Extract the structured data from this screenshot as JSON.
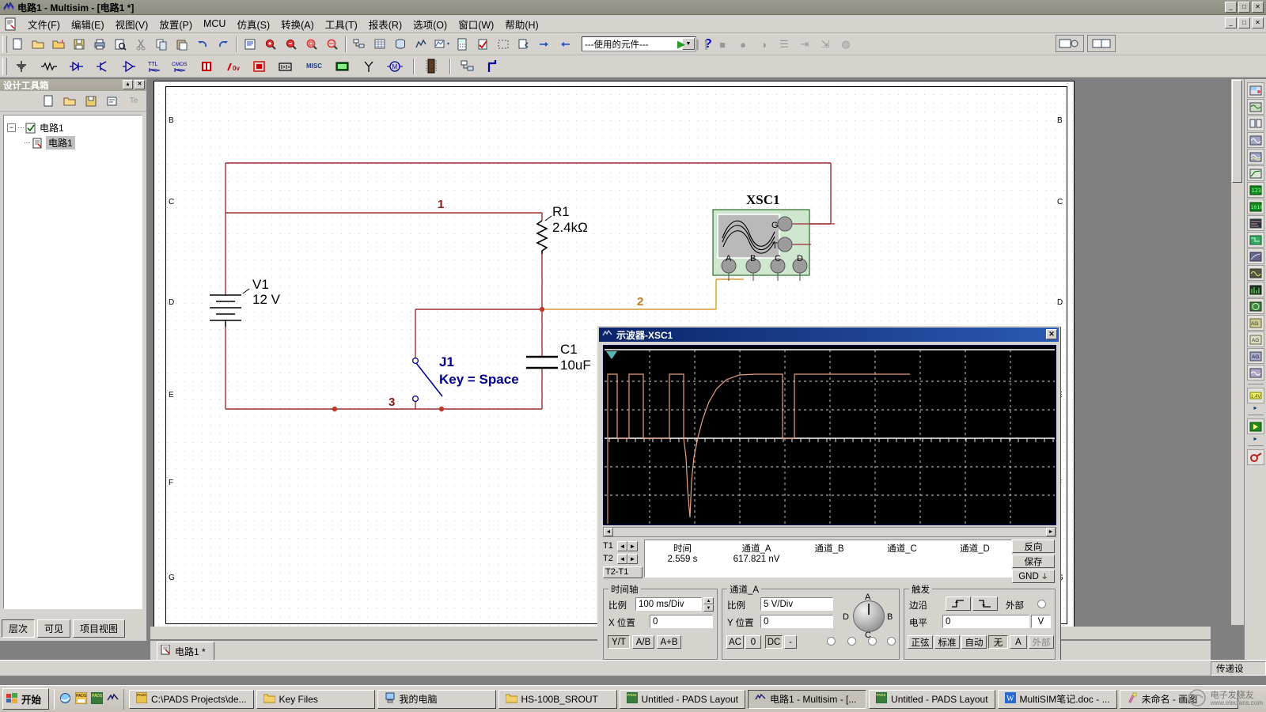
{
  "window": {
    "title": "电路1 - Multisim - [电路1 *]",
    "icon": "multisim-icon",
    "buttons": [
      "_",
      "□",
      "✕"
    ],
    "mdi_buttons": [
      "_",
      "□",
      "✕"
    ]
  },
  "menu": {
    "items": [
      {
        "label": "文件(F)",
        "name": "menu-file"
      },
      {
        "label": "编辑(E)",
        "name": "menu-edit"
      },
      {
        "label": "视图(V)",
        "name": "menu-view"
      },
      {
        "label": "放置(P)",
        "name": "menu-place"
      },
      {
        "label": "MCU",
        "name": "menu-mcu"
      },
      {
        "label": "仿真(S)",
        "name": "menu-simulate"
      },
      {
        "label": "转换(A)",
        "name": "menu-transfer"
      },
      {
        "label": "工具(T)",
        "name": "menu-tools"
      },
      {
        "label": "报表(R)",
        "name": "menu-reports"
      },
      {
        "label": "选项(O)",
        "name": "menu-options"
      },
      {
        "label": "窗口(W)",
        "name": "menu-window"
      },
      {
        "label": "帮助(H)",
        "name": "menu-help"
      }
    ]
  },
  "toolbar_main": {
    "groups": [
      [
        "new-file-icon",
        "open-file-icon",
        "open-sample-icon",
        "save-icon",
        "print-icon",
        "print-preview-icon",
        "cut-icon",
        "copy-icon",
        "paste-icon",
        "undo-icon",
        "redo-icon"
      ],
      [
        "full-screen-icon",
        "zoom-in-icon",
        "zoom-out-icon",
        "zoom-area-icon",
        "zoom-fit-icon"
      ],
      [
        "hierarchy-icon",
        "grid-icon",
        "database-icon",
        "analysis-icon",
        "postprocessor-icon",
        "calculator-icon",
        "check-icon",
        "select-area-icon",
        "back-annotate-icon",
        "forward-annotate-icon",
        "in-use-list-icon"
      ]
    ],
    "in_use_combo": "---使用的元件---",
    "help_icon": "help-question-icon"
  },
  "toolbar_components": {
    "items": [
      "source-icon",
      "basic-icon",
      "diode-icon",
      "transistor-icon",
      "analog-icon",
      "ttl-icon",
      "cmos-icon",
      "misc-digital-icon",
      "mixed-icon",
      "indicator-icon",
      "power-icon",
      "misc-icon",
      "advanced-peripheral-icon",
      "rf-icon",
      "electromech-icon",
      "mcu-icon",
      "hierarchical-block-icon",
      "bus-icon"
    ]
  },
  "simulation_controls": {
    "items": [
      "run-icon",
      "pause-icon",
      "stop-icon",
      "record-icon",
      "step-icon",
      "list-icon",
      "measure-icon",
      "grapher-icon",
      "instrument-icon"
    ],
    "run_color": "#2a9c2a",
    "right_boxes": [
      "view-mode-icon",
      "layout-mode-icon"
    ]
  },
  "design_toolbox": {
    "title": "设计工具箱",
    "header_buttons": [
      "▴",
      "✕"
    ],
    "toolbar_icons": [
      "new-sheet-icon",
      "open-sheet-icon",
      "save-sheet-icon",
      "rename-sheet-icon",
      "text-icon"
    ],
    "tree": {
      "root": {
        "label": "电路1",
        "icon": "checked-sheet-icon",
        "expander": "−"
      },
      "child": {
        "label": "电路1",
        "icon": "schematic-icon",
        "selected": true
      }
    },
    "tabs": [
      {
        "label": "层次",
        "active": true
      },
      {
        "label": "可见",
        "active": false
      },
      {
        "label": "项目视图",
        "active": false
      }
    ]
  },
  "schematic": {
    "sheet_tab": {
      "label": "电路1 *",
      "icon": "schematic-tab-icon"
    },
    "row_labels": [
      "B",
      "C",
      "D",
      "E",
      "F",
      "G"
    ],
    "components": [
      {
        "ref": "V1",
        "value": "12 V",
        "type": "dc-voltage-source"
      },
      {
        "ref": "R1",
        "value": "2.4kΩ",
        "type": "resistor"
      },
      {
        "ref": "C1",
        "value": "10uF",
        "type": "capacitor"
      },
      {
        "ref": "J1",
        "value": "Key = Space",
        "type": "spdt-switch"
      },
      {
        "ref": "XSC1",
        "value": "",
        "type": "oscilloscope"
      }
    ],
    "net_labels": [
      "1",
      "2",
      "3"
    ],
    "scope_terminals": [
      "A",
      "B",
      "C",
      "D",
      "G",
      "T"
    ]
  },
  "scope": {
    "title": "示波器-XSC1",
    "close_label": "✕",
    "readout": {
      "cursors": [
        "T1",
        "T2"
      ],
      "delta_label": "T2-T1",
      "columns": [
        "时间",
        "通道_A",
        "通道_B",
        "通道_C",
        "通道_D"
      ],
      "t1_values": [
        "2.559 s",
        "617.821 nV",
        "",
        "",
        ""
      ],
      "buttons": [
        {
          "label": "反向",
          "name": "reverse-button"
        },
        {
          "label": "保存",
          "name": "save-button"
        },
        {
          "label": "GND",
          "name": "gnd-button"
        }
      ]
    },
    "timebase": {
      "caption": "时间轴",
      "scale_label": "比例",
      "scale_value": "100 ms/Div",
      "xpos_label": "X 位置",
      "xpos_value": "0",
      "modes": [
        {
          "label": "Y/T",
          "active": true
        },
        {
          "label": "A/B",
          "active": false
        },
        {
          "label": "A+B",
          "active": false
        }
      ]
    },
    "channel_a": {
      "caption": "通道_A",
      "scale_label": "比例",
      "scale_value": "5  V/Div",
      "ypos_label": "Y 位置",
      "ypos_value": "0",
      "coupling": [
        {
          "label": "AC",
          "active": false
        },
        {
          "label": "0",
          "active": false
        },
        {
          "label": "DC",
          "active": true
        },
        {
          "label": "-",
          "active": false
        }
      ]
    },
    "channel_knob": {
      "top": "A",
      "right": "B",
      "bottom": "C",
      "left": "D"
    },
    "trigger": {
      "caption": "触发",
      "edge_label": "边沿",
      "edge_buttons": [
        "rising-edge-icon",
        "falling-edge-icon"
      ],
      "external_label": "外部",
      "level_label": "电平",
      "level_value": "0",
      "level_unit": "V",
      "sources": [
        {
          "label": "正弦",
          "active": false
        },
        {
          "label": "标准",
          "active": false
        },
        {
          "label": "自动",
          "active": false
        },
        {
          "label": "无",
          "active": true
        },
        {
          "label": "A",
          "active": false
        },
        {
          "label": "外部",
          "active": false
        }
      ]
    }
  },
  "chart_data": {
    "type": "line",
    "title": "示波器-XSC1",
    "xlabel": "时间",
    "ylabel": "通道_A",
    "x_scale": "100 ms/Div",
    "y_scale": "5 V/Div",
    "x_position": 0,
    "y_position": 0,
    "grid": true,
    "divisions": {
      "x": 10,
      "y": 8
    },
    "trace_color": "#e8a482",
    "series": [
      {
        "name": "通道_A",
        "points": [
          [
            0.0,
            0.0
          ],
          [
            0.0,
            12.0
          ],
          [
            0.02,
            12.0
          ],
          [
            0.02,
            0.0
          ],
          [
            0.05,
            0.0
          ],
          [
            0.05,
            12.0
          ],
          [
            0.08,
            12.0
          ],
          [
            0.08,
            0.0
          ],
          [
            0.13,
            0.0
          ],
          [
            0.13,
            12.0
          ],
          [
            0.18,
            12.0
          ],
          [
            0.18,
            0.0
          ],
          [
            0.19,
            -6.0
          ],
          [
            0.2,
            -12.0
          ],
          [
            0.21,
            -3.0
          ],
          [
            0.23,
            3.0
          ],
          [
            0.26,
            8.0
          ],
          [
            0.3,
            11.0
          ],
          [
            0.34,
            12.0
          ],
          [
            0.42,
            12.0
          ],
          [
            0.42,
            0.0
          ],
          [
            0.45,
            0.0
          ],
          [
            0.45,
            12.0
          ],
          [
            0.67,
            12.0
          ]
        ]
      }
    ],
    "cursor_measurements": {
      "T1": {
        "时间": "2.559 s",
        "通道_A": "617.821 nV"
      }
    }
  },
  "statusbar": {
    "right_text": "传递设"
  },
  "taskbar": {
    "start": {
      "label": "开始",
      "icon": "windows-flag-icon"
    },
    "quick_launch": [
      "ie-icon",
      "pads-icon",
      "pads-logic-icon",
      "multisim-icon"
    ],
    "tasks": [
      {
        "label": "C:\\PADS Projects\\de...",
        "icon": "pads-icon",
        "active": false
      },
      {
        "label": "Key Files",
        "icon": "folder-icon",
        "active": false
      },
      {
        "label": "我的电脑",
        "icon": "my-computer-icon",
        "active": false
      },
      {
        "label": "HS-100B_SROUT",
        "icon": "folder-icon",
        "active": false
      },
      {
        "label": "Untitled - PADS Layout",
        "icon": "pads-layout-icon",
        "active": false
      },
      {
        "label": "电路1 - Multisim - [...",
        "icon": "multisim-icon",
        "active": true
      },
      {
        "label": "Untitled - PADS Layout",
        "icon": "pads-layout-icon",
        "active": false
      },
      {
        "label": "MultiSIM笔记.doc - ...",
        "icon": "word-icon",
        "active": false
      },
      {
        "label": "未命名 - 画图",
        "icon": "paint-icon",
        "active": false
      }
    ],
    "tray": {
      "watermark": "电子发烧友",
      "watermark_sub": "www.elecfans.com"
    }
  }
}
